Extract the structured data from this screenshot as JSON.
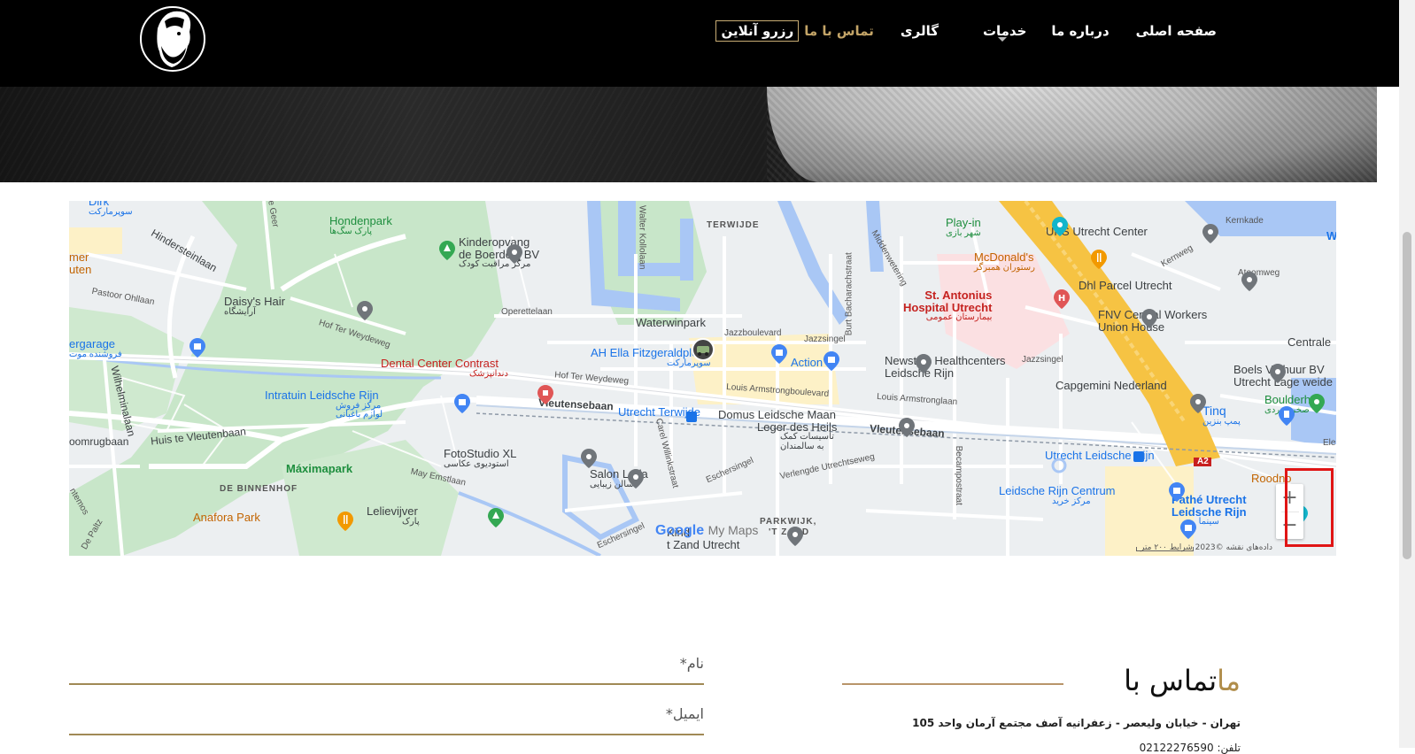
{
  "colors": {
    "header_bg": "#000000",
    "accent": "#c3a467",
    "highlight": "#e01515",
    "map_park": "#c8e6c9",
    "map_water": "#a9c7f5",
    "map_highway": "#f6c343"
  },
  "header": {
    "logo_icon": "bearded-man-logo-icon",
    "nav": [
      {
        "label": "صفحه اصلی"
      },
      {
        "label": "درباره ما"
      },
      {
        "label": "خدمات"
      },
      {
        "label": "گالری"
      },
      {
        "label": "تماس با ما"
      },
      {
        "label": "رزرو آنلاین"
      }
    ]
  },
  "map": {
    "areas": {
      "terwijde": "TERWIJDE",
      "binnenhof": "DE BINNENHOF",
      "parkwijk": "PARKWIJK,",
      "tzand": "'T ZAND",
      "maximapark": "Máximapark"
    },
    "places": {
      "dirk": "Dirk",
      "dirk_sub": "سوپرمارکت",
      "hondenpark": "Hondenpark",
      "hondenpark_sub": "پارک سگ‌ها",
      "kinderopvang1": "Kinderopvang",
      "kinderopvang2": "de Boerderij BV",
      "kinderopvang_sub": "مرکز مراقبت کودک",
      "playin": "Play-in",
      "playin_sub": "شهر بازی",
      "ups": "UPS Utrecht Center",
      "kernkade": "Kernkade",
      "mcdonalds": "McDonald's",
      "mcdonalds_sub": "رستوران همبرگر",
      "antonius1": "St. Antonius",
      "antonius2": "Hospital Utrecht",
      "antonius_sub": "بیمارستان عمومی",
      "dhl": "Dhl Parcel Utrecht",
      "atoomweg": "Atoomweg",
      "kernweg": "Kernweg",
      "fnv1": "FNV Central Workers",
      "fnv2": "Union House",
      "centrale": "Centrale",
      "daisy": "Daisy's Hair",
      "daisy_sub": "آرایشگاه",
      "waterwinpark": "Waterwinpark",
      "ah": "AH Ella Fitzgeraldplein",
      "ah_sub": "سوپرمارکت",
      "action": "Action",
      "newstyle1": "Newstyle Healthcenters",
      "newstyle2": "Leidsche Rijn",
      "boels1": "Boels Verhuur BV",
      "boels2": "Utrecht Lage weide",
      "boulderh": "Boulderh",
      "boulderh_sub": "صخره‌نوردی",
      "capgemini": "Capgemini Nederland",
      "dental": "Dental Center Contrast",
      "dental_sub": "دندانپزشک",
      "intratuin": "Intratuin Leidsche Rijn",
      "intratuin_sub1": "مرکز فروش",
      "intratuin_sub2": "لوازم باغبانی",
      "terwijde_station": "Utrecht Terwijde",
      "domus1": "Domus Leidsche Maan",
      "domus2": "Leger des Heils",
      "domus_sub1": "تأسیسات کمک",
      "domus_sub2": "به سالمندان",
      "tinq": "Tinq",
      "tinq_sub": "پمپ بنزین",
      "fotostudio": "FotoStudio XL",
      "fotostudio_sub": "استودیوی عکاسی",
      "salon": "Salon Luda",
      "salon_sub": "سالن زیبایی",
      "lr_station": "Utrecht Leidsche Rijn",
      "lr_centrum": "Leidsche Rijn Centrum",
      "lr_centrum_sub": "مرکز خرید",
      "pathe1": "Pathé Utrecht",
      "pathe2": "Leidsche Rijn",
      "pathe_sub": "سینما",
      "roodnoot": "Roodno",
      "lelievijver": "Lelievijver",
      "lelievijver_sub": "پارک",
      "anafora": "Anafora Park",
      "zand_utrecht": "t Zand Utrecht",
      "kind": "Kind",
      "ergarage": "ergarage",
      "ergarage_sub": "فروشنده موت",
      "mer": "mer",
      "uten": "uten",
      "ele": "Ele",
      "w": "W"
    },
    "roads": {
      "vleutensebaan": "Vleutensebaan",
      "vleutensebaan2": "Vleutensebaan",
      "hof_ter_weydeweg": "Hof Ter Weydeweg",
      "hof_ter_weydeweg2": "Hof Ter Weydeweg",
      "louis1": "Louis Armstrongboulevard",
      "louis2": "Louis Armstronglaan",
      "jazzboulevard": "Jazzboulevard",
      "jazzsingel": "Jazzsingel",
      "jazzsingel2": "Jazzsingel",
      "operettelaan": "Operettelaan",
      "huis_te_vleutenbaan": "Huis te Vleutenbaan",
      "wilhelminalaan": "Wilhelminalaan",
      "hindersteinlaan": "Hindersteinlaan",
      "pastoor": "Pastoor Ohllaan",
      "ommrugbaan": "oomrugbaan",
      "a2": "A2",
      "eschersingel": "Eschersingel",
      "eschersingel2": "Eschersingel",
      "verlengde": "Verlengde Utrechtseweg",
      "may_emstlaan": "May Emstlaan",
      "carel": "Carel Willinkstraat",
      "walter": "Walter Kollolaan",
      "burt": "Burt Bacharachstraat",
      "middenwetering": "Middenwetering",
      "becampostraat": "Becampostraat",
      "de_geer": "De Geer",
      "de_paltz": "De Paltz",
      "deutemos": "ntemos"
    },
    "google_logo": "Google",
    "my_maps": "My Maps",
    "attribution": "داده‌های نقشه ©2023 شرایط ۲۰۰ متر",
    "zoom_in": "+",
    "zoom_out": "−"
  },
  "contact": {
    "title_main": "تماس با",
    "title_accent": "ما",
    "address": "تهران - خیابان ولیعصر - زعفرانیه آصف مجتمع آرمان واحد 105",
    "phone": "تلفن: 02122276590",
    "name_label": "نام*",
    "email_label": "ایمیل*"
  }
}
